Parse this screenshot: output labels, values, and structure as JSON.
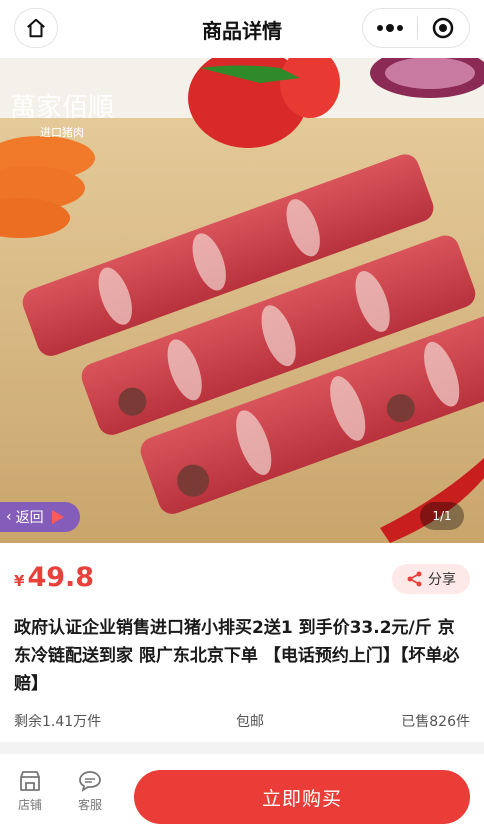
{
  "header": {
    "title": "商品详情"
  },
  "hero": {
    "logo_text": "萬家佰順",
    "logo_sub": "进口猪肉",
    "back_label": "返回",
    "page_indicator": "1/1"
  },
  "price": {
    "currency": "¥",
    "value": "49.8"
  },
  "share_label": "分享",
  "product": {
    "title": "政府认证企业销售进口猪小排买2送1 到手价33.2元/斤 京东冷链配送到家 限广东北京下单 【电话预约上门】【坏单必赔】"
  },
  "meta": {
    "stock": "剩余1.41万件",
    "shipping": "包邮",
    "sold": "已售826件"
  },
  "bottom": {
    "shop_label": "店铺",
    "service_label": "客服",
    "buy_label": "立即购买"
  },
  "colors": {
    "accent": "#ea3d37",
    "price": "#e8413b"
  }
}
